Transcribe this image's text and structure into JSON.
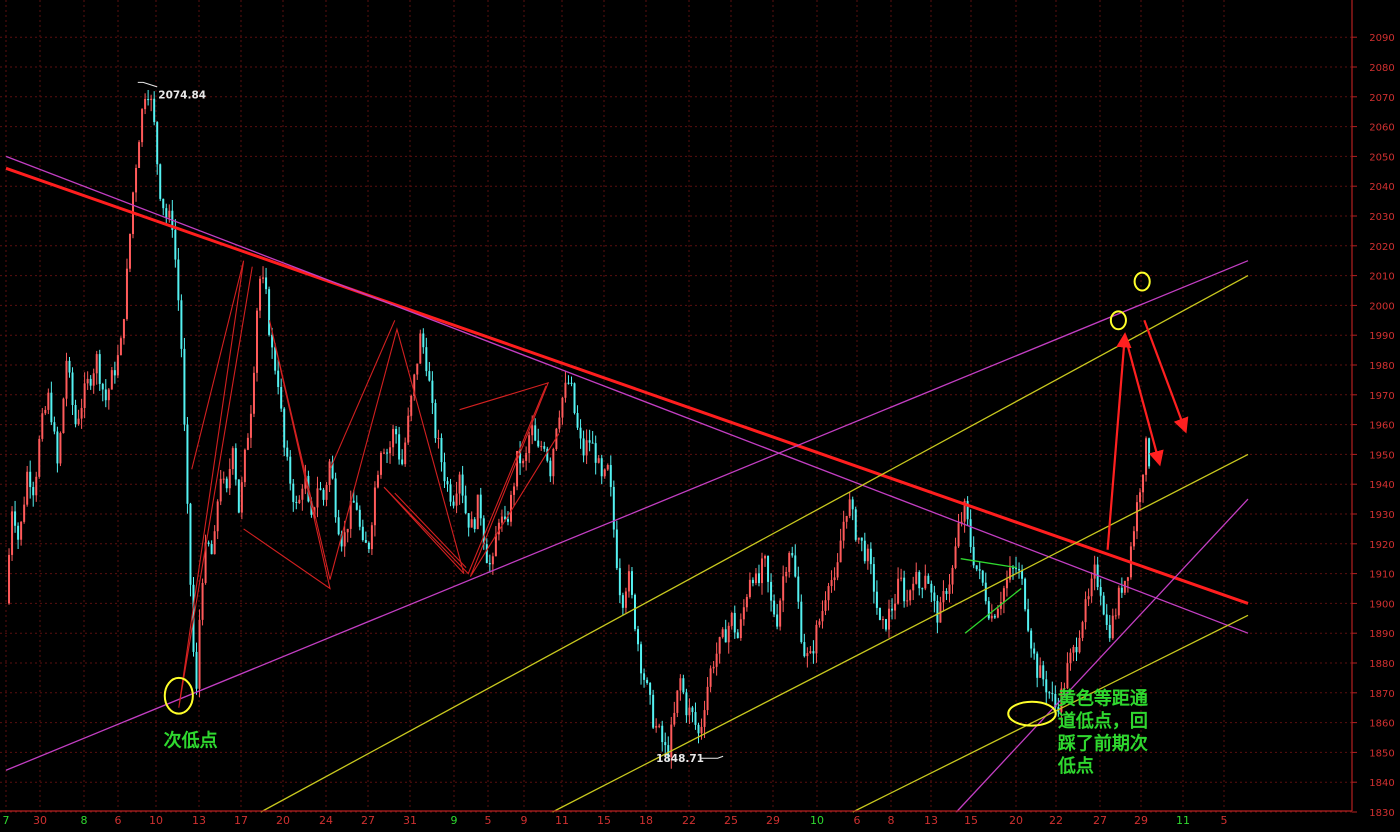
{
  "chart_data": {
    "type": "candlestick",
    "title": "",
    "xlabel": "",
    "ylabel": "",
    "ylim": [
      1830,
      2090
    ],
    "y_ticks": [
      1830,
      1840,
      1850,
      1860,
      1870,
      1880,
      1890,
      1900,
      1910,
      1920,
      1930,
      1940,
      1950,
      1960,
      1970,
      1980,
      1990,
      2000,
      2010,
      2020,
      2030,
      2040,
      2050,
      2060,
      2070,
      2080,
      2090
    ],
    "x_ticks": [
      {
        "label": "7",
        "color": "#2fd82f"
      },
      {
        "label": "30",
        "color": "#d03030"
      },
      {
        "label": "8",
        "color": "#2fd82f"
      },
      {
        "label": "6",
        "color": "#d03030"
      },
      {
        "label": "10",
        "color": "#d03030"
      },
      {
        "label": "13",
        "color": "#d03030"
      },
      {
        "label": "17",
        "color": "#d03030"
      },
      {
        "label": "20",
        "color": "#d03030"
      },
      {
        "label": "24",
        "color": "#d03030"
      },
      {
        "label": "27",
        "color": "#d03030"
      },
      {
        "label": "31",
        "color": "#d03030"
      },
      {
        "label": "9",
        "color": "#2fd82f"
      },
      {
        "label": "5",
        "color": "#d03030"
      },
      {
        "label": "9",
        "color": "#d03030"
      },
      {
        "label": "11",
        "color": "#d03030"
      },
      {
        "label": "15",
        "color": "#d03030"
      },
      {
        "label": "18",
        "color": "#d03030"
      },
      {
        "label": "22",
        "color": "#d03030"
      },
      {
        "label": "25",
        "color": "#d03030"
      },
      {
        "label": "29",
        "color": "#d03030"
      },
      {
        "label": "10",
        "color": "#2fd82f"
      },
      {
        "label": "6",
        "color": "#d03030"
      },
      {
        "label": "8",
        "color": "#d03030"
      },
      {
        "label": "13",
        "color": "#d03030"
      },
      {
        "label": "15",
        "color": "#d03030"
      },
      {
        "label": "20",
        "color": "#d03030"
      },
      {
        "label": "22",
        "color": "#d03030"
      },
      {
        "label": "27",
        "color": "#d03030"
      },
      {
        "label": "29",
        "color": "#d03030"
      },
      {
        "label": "11",
        "color": "#2fd82f"
      },
      {
        "label": "5",
        "color": "#d03030"
      }
    ],
    "price_labels": [
      {
        "text": "2074.84",
        "value": 2074.84
      },
      {
        "text": "1848.71",
        "value": 1848.71
      }
    ],
    "price_path": [
      [
        0,
        1900
      ],
      [
        0.3,
        1935
      ],
      [
        0.6,
        1920
      ],
      [
        1.0,
        1945
      ],
      [
        1.3,
        1938
      ],
      [
        1.6,
        1958
      ],
      [
        2.0,
        1970
      ],
      [
        2.4,
        1945
      ],
      [
        2.8,
        1982
      ],
      [
        3.2,
        1960
      ],
      [
        3.7,
        1972
      ],
      [
        4.2,
        1982
      ],
      [
        4.6,
        1968
      ],
      [
        5.0,
        1978
      ],
      [
        5.3,
        1985
      ],
      [
        5.6,
        2010
      ],
      [
        5.9,
        2040
      ],
      [
        6.2,
        2060
      ],
      [
        6.5,
        2075
      ],
      [
        6.8,
        2065
      ],
      [
        7.1,
        2040
      ],
      [
        7.4,
        2030
      ],
      [
        7.7,
        2028
      ],
      [
        7.9,
        2010
      ],
      [
        8.1,
        1990
      ],
      [
        8.4,
        1930
      ],
      [
        8.7,
        1880
      ],
      [
        8.85,
        1867
      ],
      [
        9.0,
        1905
      ],
      [
        9.3,
        1920
      ],
      [
        9.6,
        1915
      ],
      [
        9.9,
        1945
      ],
      [
        10.2,
        1935
      ],
      [
        10.5,
        1955
      ],
      [
        10.8,
        1930
      ],
      [
        11.0,
        1945
      ],
      [
        11.4,
        1970
      ],
      [
        11.7,
        2010
      ],
      [
        12.0,
        2005
      ],
      [
        12.3,
        1985
      ],
      [
        12.6,
        1975
      ],
      [
        12.9,
        1950
      ],
      [
        13.2,
        1940
      ],
      [
        13.5,
        1930
      ],
      [
        13.8,
        1945
      ],
      [
        14.1,
        1925
      ],
      [
        14.4,
        1940
      ],
      [
        14.7,
        1935
      ],
      [
        15.0,
        1948
      ],
      [
        15.3,
        1930
      ],
      [
        15.6,
        1920
      ],
      [
        15.9,
        1930
      ],
      [
        16.2,
        1935
      ],
      [
        16.5,
        1918
      ],
      [
        16.8,
        1920
      ],
      [
        17.1,
        1940
      ],
      [
        17.4,
        1955
      ],
      [
        17.7,
        1950
      ],
      [
        18.0,
        1960
      ],
      [
        18.3,
        1945
      ],
      [
        18.6,
        1960
      ],
      [
        18.9,
        1975
      ],
      [
        19.2,
        1990
      ],
      [
        19.5,
        1980
      ],
      [
        19.8,
        1960
      ],
      [
        20.1,
        1950
      ],
      [
        20.4,
        1940
      ],
      [
        20.7,
        1935
      ],
      [
        21.0,
        1945
      ],
      [
        21.3,
        1930
      ],
      [
        21.6,
        1925
      ],
      [
        21.9,
        1935
      ],
      [
        22.2,
        1918
      ],
      [
        22.5,
        1910
      ],
      [
        22.8,
        1930
      ],
      [
        23.1,
        1925
      ],
      [
        23.4,
        1935
      ],
      [
        23.7,
        1950
      ],
      [
        24.0,
        1945
      ],
      [
        24.3,
        1960
      ],
      [
        24.6,
        1950
      ],
      [
        24.9,
        1955
      ],
      [
        25.2,
        1945
      ],
      [
        25.5,
        1962
      ],
      [
        25.8,
        1970
      ],
      [
        26.1,
        1975
      ],
      [
        26.4,
        1960
      ],
      [
        26.7,
        1950
      ],
      [
        27.0,
        1955
      ],
      [
        27.3,
        1950
      ],
      [
        27.6,
        1940
      ],
      [
        27.9,
        1945
      ],
      [
        28.2,
        1920
      ],
      [
        28.5,
        1900
      ],
      [
        28.8,
        1910
      ],
      [
        29.1,
        1895
      ],
      [
        29.4,
        1880
      ],
      [
        29.7,
        1870
      ],
      [
        30.0,
        1860
      ],
      [
        30.3,
        1855
      ],
      [
        30.6,
        1849
      ],
      [
        30.9,
        1860
      ],
      [
        31.2,
        1875
      ],
      [
        31.5,
        1865
      ],
      [
        31.8,
        1862
      ],
      [
        32.1,
        1855
      ],
      [
        32.4,
        1870
      ],
      [
        32.7,
        1880
      ],
      [
        33.0,
        1885
      ],
      [
        33.3,
        1890
      ],
      [
        33.6,
        1895
      ],
      [
        33.9,
        1888
      ],
      [
        34.2,
        1900
      ],
      [
        34.5,
        1912
      ],
      [
        34.8,
        1905
      ],
      [
        35.1,
        1915
      ],
      [
        35.4,
        1900
      ],
      [
        35.7,
        1895
      ],
      [
        36.0,
        1910
      ],
      [
        36.3,
        1920
      ],
      [
        36.6,
        1905
      ],
      [
        36.9,
        1885
      ],
      [
        37.2,
        1880
      ],
      [
        37.5,
        1890
      ],
      [
        37.8,
        1898
      ],
      [
        38.1,
        1910
      ],
      [
        38.4,
        1905
      ],
      [
        38.7,
        1925
      ],
      [
        39.0,
        1935
      ],
      [
        39.3,
        1925
      ],
      [
        39.6,
        1920
      ],
      [
        39.9,
        1915
      ],
      [
        40.2,
        1905
      ],
      [
        40.5,
        1890
      ],
      [
        40.8,
        1895
      ],
      [
        41.1,
        1900
      ],
      [
        41.4,
        1908
      ],
      [
        41.7,
        1900
      ],
      [
        42.0,
        1910
      ],
      [
        42.3,
        1905
      ],
      [
        42.6,
        1912
      ],
      [
        42.9,
        1900
      ],
      [
        43.2,
        1895
      ],
      [
        43.5,
        1905
      ],
      [
        43.8,
        1910
      ],
      [
        44.1,
        1925
      ],
      [
        44.4,
        1932
      ],
      [
        44.7,
        1918
      ],
      [
        45.0,
        1910
      ],
      [
        45.3,
        1905
      ],
      [
        45.6,
        1895
      ],
      [
        45.9,
        1900
      ],
      [
        46.2,
        1905
      ],
      [
        46.5,
        1910
      ],
      [
        46.8,
        1912
      ],
      [
        47.1,
        1905
      ],
      [
        47.4,
        1890
      ],
      [
        47.7,
        1878
      ],
      [
        48.0,
        1875
      ],
      [
        48.3,
        1870
      ],
      [
        48.6,
        1865
      ],
      [
        48.9,
        1870
      ],
      [
        49.2,
        1880
      ],
      [
        49.5,
        1885
      ],
      [
        49.8,
        1895
      ],
      [
        50.1,
        1900
      ],
      [
        50.4,
        1910
      ],
      [
        50.7,
        1905
      ],
      [
        51.0,
        1890
      ],
      [
        51.3,
        1895
      ],
      [
        51.6,
        1905
      ],
      [
        51.9,
        1910
      ],
      [
        52.2,
        1925
      ],
      [
        52.5,
        1940
      ],
      [
        52.8,
        1953
      ],
      [
        53.0,
        1945
      ]
    ],
    "lines": [
      {
        "name": "main-downtrend",
        "color": "#ff1e1e",
        "width": 3,
        "from": [
          0,
          2046
        ],
        "to": [
          57.5,
          1900
        ]
      },
      {
        "name": "magenta-downtrend",
        "color": "#c23ec2",
        "width": 1.3,
        "from": [
          0,
          2050
        ],
        "to": [
          57.5,
          1890
        ]
      },
      {
        "name": "magenta-uptrend",
        "color": "#c23ec2",
        "width": 1.3,
        "from": [
          0,
          1844
        ],
        "to": [
          57.5,
          2015
        ]
      },
      {
        "name": "magenta-steep",
        "color": "#c23ec2",
        "width": 1.3,
        "from": [
          44,
          1830
        ],
        "to": [
          57.5,
          1935
        ]
      },
      {
        "name": "yellow-channel-upper",
        "color": "#c8c81e",
        "width": 1.3,
        "from": [
          11.8,
          1830
        ],
        "to": [
          57.5,
          2010
        ]
      },
      {
        "name": "yellow-channel-mid",
        "color": "#c8c81e",
        "width": 1.3,
        "from": [
          25.3,
          1830
        ],
        "to": [
          57.5,
          1950
        ]
      },
      {
        "name": "yellow-channel-lower",
        "color": "#c8c81e",
        "width": 1.3,
        "from": [
          39.2,
          1830
        ],
        "to": [
          57.5,
          1896
        ]
      },
      {
        "name": "green-wedge-upper",
        "color": "#2fd82f",
        "width": 1.3,
        "from": [
          44.2,
          1915
        ],
        "to": [
          46.8,
          1912
        ]
      },
      {
        "name": "green-wedge-lower",
        "color": "#2fd82f",
        "width": 1.3,
        "from": [
          44.4,
          1890
        ],
        "to": [
          47.0,
          1905
        ]
      }
    ],
    "zigzags": [
      {
        "color": "#d22020",
        "points": [
          [
            8.6,
            1945
          ],
          [
            11.0,
            2015
          ],
          [
            8.0,
            1865
          ],
          [
            11.4,
            2013
          ]
        ]
      },
      {
        "color": "#d22020",
        "points": [
          [
            11.0,
            1925
          ],
          [
            15.0,
            1905
          ],
          [
            12.2,
            1995
          ],
          [
            15.0,
            1908
          ],
          [
            18.1,
            1992
          ],
          [
            21.2,
            1910
          ],
          [
            17.5,
            1939
          ],
          [
            21.4,
            1910
          ],
          [
            25.0,
            1973
          ]
        ]
      },
      {
        "color": "#d22020",
        "points": [
          [
            15.0,
            1945
          ],
          [
            18.0,
            1995
          ]
        ]
      },
      {
        "color": "#d22020",
        "points": [
          [
            18.0,
            1937
          ],
          [
            21.3,
            1912
          ]
        ]
      },
      {
        "color": "#d22020",
        "points": [
          [
            21.0,
            1965
          ],
          [
            25.1,
            1974
          ],
          [
            21.5,
            1909
          ],
          [
            25.6,
            1957
          ]
        ]
      }
    ],
    "arrows": [
      {
        "color": "#ff2020",
        "from": [
          51.0,
          1918
        ],
        "to": [
          51.8,
          1990
        ]
      },
      {
        "color": "#ff2020",
        "from": [
          51.8,
          1990
        ],
        "to": [
          53.4,
          1947
        ]
      },
      {
        "color": "#ff2020",
        "from": [
          52.7,
          1995
        ],
        "to": [
          54.6,
          1958
        ]
      }
    ],
    "circles": [
      {
        "name": "second-low-circle",
        "at": [
          8.0,
          1869
        ],
        "rx_days": 0.65,
        "ry_price": 6.0
      },
      {
        "name": "channel-low-circle",
        "at": [
          47.5,
          1863
        ],
        "rx_days": 1.1,
        "ry_price": 4.0
      },
      {
        "name": "target-circle-1",
        "at": [
          51.5,
          1995
        ],
        "rx_days": 0.35,
        "ry_price": 3.0
      },
      {
        "name": "target-circle-2",
        "at": [
          52.6,
          2008
        ],
        "rx_days": 0.35,
        "ry_price": 3.0
      }
    ],
    "annotations": [
      {
        "name": "second-low-annotation",
        "lines": [
          "次低点"
        ],
        "at": [
          7.3,
          1852
        ]
      },
      {
        "name": "channel-low-annotation",
        "lines": [
          "黄色等距通",
          "道低点，回",
          "踩了前期次",
          "低点"
        ],
        "at": [
          48.7,
          1866
        ]
      }
    ]
  }
}
